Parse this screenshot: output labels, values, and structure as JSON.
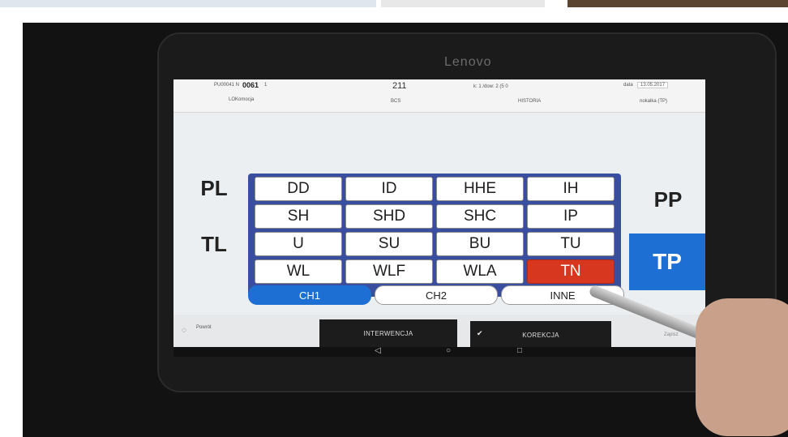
{
  "device": {
    "brand": "Lenovo"
  },
  "header": {
    "id_label": "PU00041 N",
    "id_value": "0061",
    "id_suffix": "1",
    "loco_label": "LOKomocja",
    "number": "211",
    "bcs_label": "BCS",
    "counter_text": "k: 1  /dow: 2 (5  0",
    "historia_label": "HISTORIA",
    "date_label": "data",
    "date_value": "13.05.2017",
    "status_right": "nokalka (TP)"
  },
  "sides": {
    "pl": "PL",
    "tl": "TL",
    "pp": "PP",
    "tp": "TP"
  },
  "grid": {
    "rows": [
      [
        "DD",
        "ID",
        "HHE",
        "IH"
      ],
      [
        "SH",
        "SHD",
        "SHC",
        "IP"
      ],
      [
        "U",
        "SU",
        "BU",
        "TU"
      ],
      [
        "WL",
        "WLF",
        "WLA",
        "TN"
      ]
    ],
    "active": "TN"
  },
  "tabs": {
    "ch1": "CH1",
    "ch2": "CH2",
    "inne": "INNE"
  },
  "bottom": {
    "powrot": "Powrót",
    "interwencja": "INTERWENCJA",
    "check": "✔",
    "korekcja": "KOREKCJA",
    "zapisz": "Zapisz"
  },
  "nav": {
    "back": "◁",
    "home": "○",
    "recent": "□"
  },
  "colors": {
    "accent_blue": "#1e6fd4",
    "active_red": "#d6371e",
    "grid_blue": "#3a4ea0"
  }
}
